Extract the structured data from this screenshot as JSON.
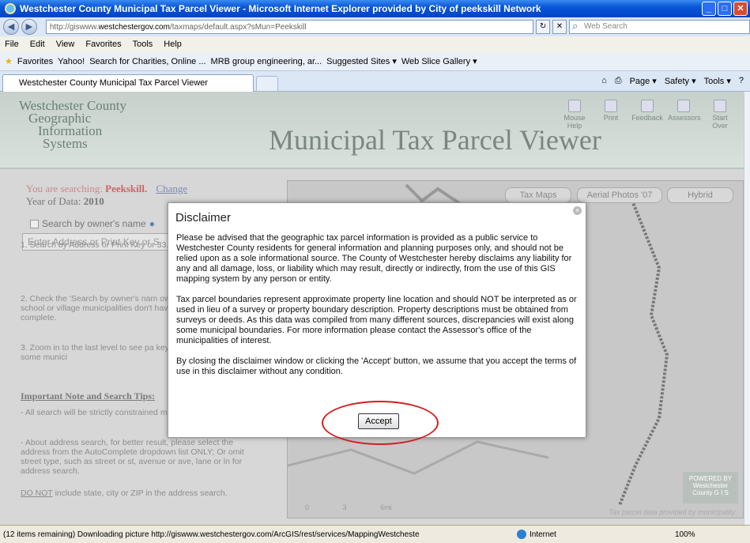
{
  "window": {
    "title": "Westchester County Municipal Tax Parcel Viewer - Microsoft Internet Explorer provided by City of peekskill Network"
  },
  "address": {
    "url_prefix": "http://giswww.",
    "url_host": "westchestergov.com",
    "url_path": "/taxmaps/default.aspx?sMun=Peekskill",
    "search_placeholder": "Web Search"
  },
  "menu": [
    "File",
    "Edit",
    "View",
    "Favorites",
    "Tools",
    "Help"
  ],
  "favorites": {
    "label": "Favorites",
    "items": [
      "Yahoo!",
      "Search for Charities, Online ...",
      "MRB group engineering, ar...",
      "Suggested Sites ▾",
      "Web Slice Gallery ▾"
    ]
  },
  "tab": {
    "title": "Westchester County Municipal Tax Parcel Viewer"
  },
  "commands": [
    "Page ▾",
    "Safety ▾",
    "Tools ▾"
  ],
  "header": {
    "logo": [
      "Westchester County",
      "Geographic",
      "Information",
      "Systems"
    ],
    "title": "Municipal Tax Parcel Viewer",
    "tools": [
      "Mouse Help",
      "Print",
      "Feedback",
      "Assessors",
      "Start Over"
    ]
  },
  "left": {
    "searching_prefix": "You are searching:",
    "municipality": "Peekskill.",
    "change": "Change",
    "year_prefix": "Year of Data:",
    "year": "2010",
    "owner_label": "Search by owner's name",
    "input_placeholder": "Enter Address or Print Key or S",
    "tip1": "1. Search by Address or Print Key or 33.46-2-2 or 1031 elm",
    "tip2": "2. Check the 'Search by owner's nam owner. For example, school or village municipalities don't have ownership d complete.",
    "tip3": "3. Zoom in to the last level to see pa key, or annotations (for some munici",
    "tips_heading": "Important Note and Search Tips:",
    "tip4": "- All search will be strictly constrained municipality.",
    "tip5": "- About address search, for better result, please select the address from the AutoComplete dropdown list ONLY; Or omit street type, such as street or st, avenue or ave, lane or ln for address search.",
    "tip6_link": "DO NOT",
    "tip6": " include state, city or ZIP in the address search."
  },
  "map": {
    "tabs": [
      "Tax Maps",
      "Aerial Photos '07",
      "Hybrid"
    ],
    "note": "Tax parcel data provided by municipality.",
    "badge": "POWERED BY Westchester County G I S",
    "scale": [
      "0",
      "3",
      "6mi"
    ]
  },
  "dialog": {
    "title": "Disclaimer",
    "p1": "Please be advised that the geographic tax parcel information is provided as a public service to Westchester County residents for general information and planning purposes only, and should not be relied upon as a sole informational source. The County of Westchester hereby disclaims any liability for any and all damage, loss, or liability which may result, directly or indirectly, from the use of this GIS mapping system by any person or entity.",
    "p2": "Tax parcel boundaries represent approximate property line location and should NOT be interpreted as or used in lieu of a survey or property boundary description. Property descriptions must be obtained from surveys or deeds. As this data was compiled from many different sources, discrepancies will exist along some municipal boundaries. For more information please contact the Assessor's office of the municipalities of interest.",
    "p3": "By closing the disclaimer window or clicking the 'Accept' button, we assume that you accept the terms of use in this disclaimer without any condition.",
    "accept": "Accept"
  },
  "status": {
    "message": "(12 items remaining) Downloading picture http://giswww.westchestergov.com/ArcGIS/rest/services/MappingWestcheste",
    "zone": "Internet",
    "zoom": "100%"
  }
}
